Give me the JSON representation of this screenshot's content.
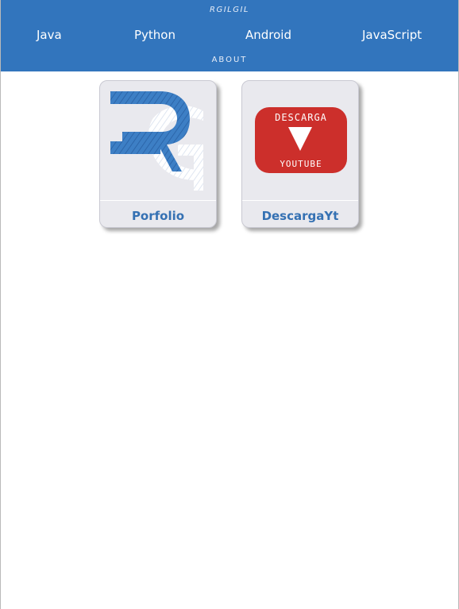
{
  "header": {
    "brand": "RGILGIL",
    "nav": [
      "Java",
      "Python",
      "Android",
      "JavaScript"
    ],
    "about": "ABOUT"
  },
  "cards": [
    {
      "title": "Porfolio",
      "icon": "rg-logo-icon"
    },
    {
      "title": "DescargaYt",
      "icon": "youtube-download-icon",
      "logo_text_top": "DESCARGA",
      "logo_text_bottom": "YOUTUBE"
    }
  ],
  "colors": {
    "header": "#3275bd",
    "card_bg": "#e9e9ee",
    "card_title": "#3571b3",
    "youtube_red": "#cc2f2b"
  }
}
